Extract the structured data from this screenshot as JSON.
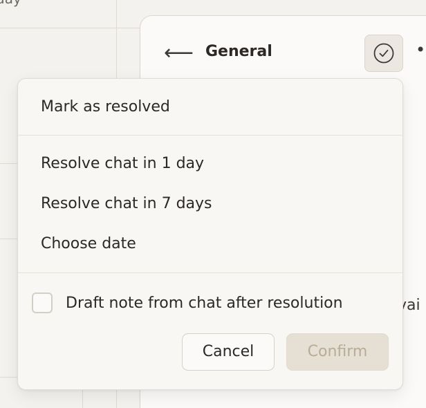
{
  "background": {
    "day_label": "day"
  },
  "panel": {
    "back_icon": "back-arrow-icon",
    "back_glyph": "⟵",
    "title": "General",
    "resolve_icon": "check-circle-icon",
    "more_icon": "more-dots-icon",
    "more_glyph": "••",
    "partial_text": "vai"
  },
  "menu": {
    "mark_resolved": "Mark as resolved",
    "options": [
      "Resolve chat in 1 day",
      "Resolve chat in 7 days",
      "Choose date"
    ],
    "draft_note_label": "Draft note from chat after resolution",
    "draft_note_checked": false,
    "cancel_label": "Cancel",
    "confirm_label": "Confirm"
  },
  "colors": {
    "background": "#f4f2ee",
    "popover": "#f8f7f4",
    "confirm_disabled_bg": "#e6dfd3",
    "confirm_disabled_text": "#b9ac97"
  }
}
